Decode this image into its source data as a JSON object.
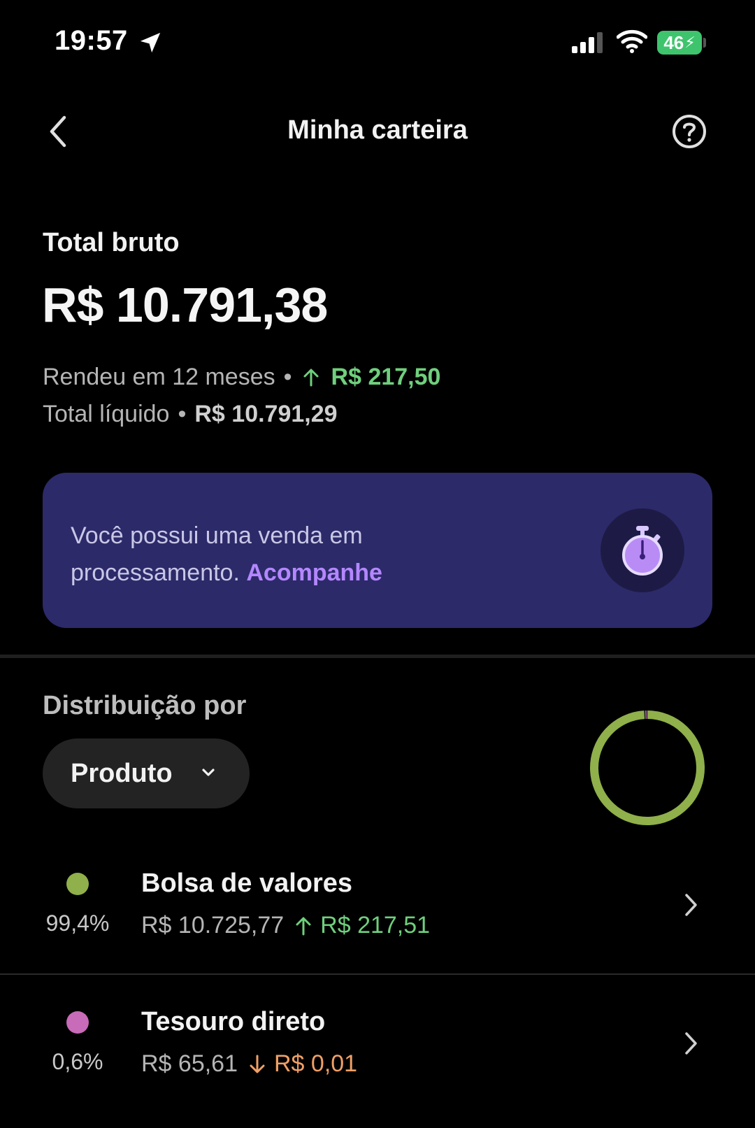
{
  "status_bar": {
    "time": "19:57",
    "battery": "46",
    "icons": [
      "location-arrow-icon",
      "signal-icon",
      "wifi-icon",
      "battery-icon"
    ]
  },
  "nav": {
    "title": "Minha carteira",
    "back_icon": "chevron-left-icon",
    "help_icon": "question-circle-icon"
  },
  "summary": {
    "total_label": "Total bruto",
    "total_value": "R$ 10.791,38",
    "yield_label": "Rendeu em 12 meses",
    "yield_value": "R$ 217,50",
    "net_label": "Total líquido",
    "net_value": "R$ 10.791,29"
  },
  "banner": {
    "text": "Você possui uma venda em processamento.",
    "link": "Acompanhe",
    "icon": "stopwatch-icon"
  },
  "distribution": {
    "label": "Distribuição por",
    "selector": "Produto",
    "items": [
      {
        "name": "Bolsa de valores",
        "percent": "99,4%",
        "amount": "R$ 10.725,77",
        "change": "R$ 217,51",
        "direction": "up",
        "color": "#8fb04a",
        "share": 0.994
      },
      {
        "name": "Tesouro direto",
        "percent": "0,6%",
        "amount": "R$ 65,61",
        "change": "R$ 0,01",
        "direction": "down",
        "color": "#c86bb8",
        "share": 0.006
      }
    ]
  },
  "colors": {
    "positive": "#6fcf7d",
    "negative": "#f0a066",
    "banner_bg": "#2c2a69",
    "link": "#b487ff"
  }
}
